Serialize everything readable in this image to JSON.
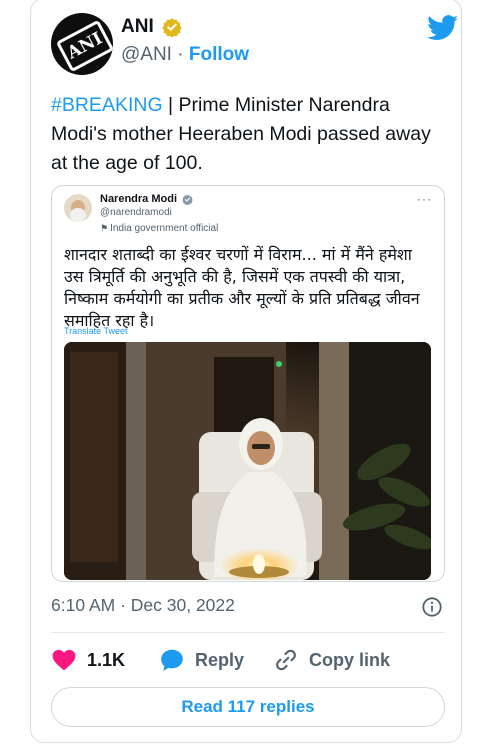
{
  "author": {
    "display_name": "ANI",
    "handle": "@ANI",
    "separator": "·",
    "follow_label": "Follow",
    "avatar_text": "ANI"
  },
  "tweet": {
    "hashtag": "#BREAKING",
    "text": " | Prime Minister Narendra Modi's mother Heeraben Modi passed away at the age of 100.",
    "timestamp": "6:10 AM · Dec 30, 2022"
  },
  "quoted": {
    "display_name": "Narendra Modi",
    "handle": "@narendramodi",
    "label": "India government official",
    "more": "···",
    "text": "शानदार शताब्दी का ईश्वर चरणों में विराम... मां में मैंने हमेशा उस त्रिमूर्ति की अनुभूति की है, जिसमें एक तपस्वी की यात्रा, निष्काम कर्मयोगी का प्रतीक और मूल्यों के प्रति प्रतिबद्ध जीवन समाहित रहा है।",
    "translate_label": "Translate Tweet"
  },
  "actions": {
    "likes_count": "1.1K",
    "reply_label": "Reply",
    "copy_label": "Copy link"
  },
  "read_replies_label": "Read 117 replies",
  "colors": {
    "accent": "#1d9bf0",
    "like": "#f91880",
    "muted": "#536471",
    "verified_gold": "#e2b719"
  },
  "icons": [
    "twitter-bird-icon",
    "verified-badge-icon",
    "info-icon",
    "heart-icon",
    "reply-bubble-icon",
    "link-icon",
    "flag-icon",
    "more-icon"
  ]
}
